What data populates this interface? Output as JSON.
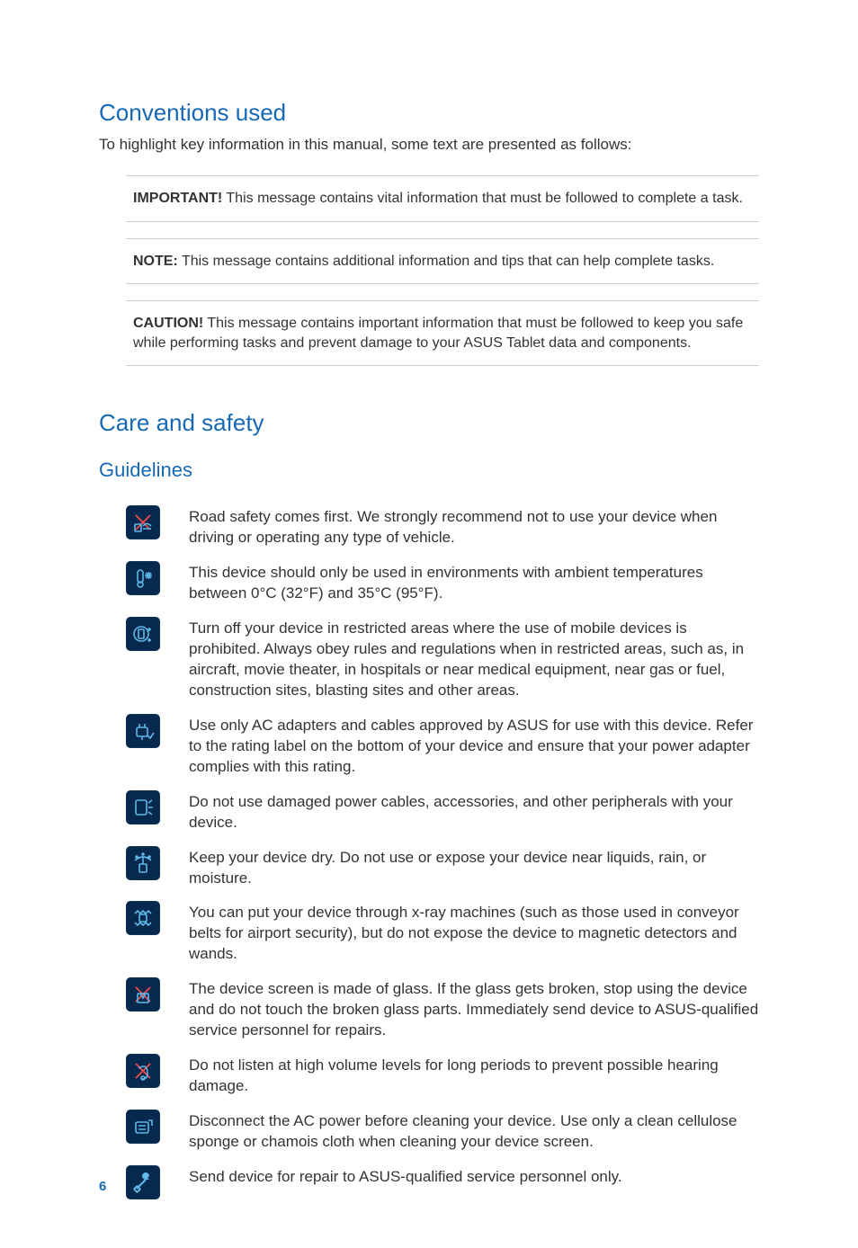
{
  "sections": {
    "conventions": {
      "title": "Conventions used",
      "intro": "To highlight key information in this manual, some text are presented as follows:",
      "callouts": [
        {
          "lead": "IMPORTANT!",
          "text": " This message contains vital information that must be followed to complete a task."
        },
        {
          "lead": "NOTE:",
          "text": " This message contains additional information and tips that can help complete tasks."
        },
        {
          "lead": "CAUTION!",
          "text": " This message contains important information that must be followed to keep you safe while performing tasks and prevent damage to your ASUS Tablet data and components."
        }
      ]
    },
    "care": {
      "title": "Care and safety",
      "subtitle": "Guidelines",
      "items": [
        {
          "icon": "no-driving-icon",
          "text": "Road safety comes first. We strongly recommend not to use your device when driving or operating any type of vehicle."
        },
        {
          "icon": "temperature-icon",
          "text": "This device should only be used in environments with ambient temperatures between 0°C (32°F) and 35°C (95°F)."
        },
        {
          "icon": "restricted-area-icon",
          "text": "Turn off your device in restricted areas where the use of mobile devices is prohibited. Always obey rules and regulations when in restricted areas, such as, in aircraft, movie theater, in hospitals or near medical equipment, near gas or fuel, construction sites, blasting sites and other areas."
        },
        {
          "icon": "approved-adapter-icon",
          "text": "Use only AC adapters and cables approved by ASUS for use with this device. Refer to the rating label on the bottom of your device and ensure that your power adapter complies with this rating."
        },
        {
          "icon": "damaged-cable-icon",
          "text": "Do not use damaged power cables, accessories, and other peripherals with your device."
        },
        {
          "icon": "keep-dry-icon",
          "text": "Keep your device dry. Do not use or expose your device near liquids, rain, or moisture."
        },
        {
          "icon": "xray-icon",
          "text": "You can put your device through x-ray machines (such as those used in conveyor belts for airport security), but do not expose the device to magnetic detectors and wands."
        },
        {
          "icon": "broken-glass-icon",
          "text": "The device screen is made of glass. If the glass gets broken, stop using the device and do not touch the broken glass parts. Immediately send device to ASUS-qualified service personnel for repairs."
        },
        {
          "icon": "hearing-icon",
          "text": "Do not listen at high volume levels for long periods to prevent possible hearing damage."
        },
        {
          "icon": "cleaning-icon",
          "text": "Disconnect the AC power before cleaning your device. Use only a clean cellulose sponge or chamois cloth when cleaning your device screen."
        },
        {
          "icon": "repair-icon",
          "text": "Send device for repair to ASUS-qualified service personnel only."
        }
      ]
    }
  },
  "icons": {
    "no-driving-icon": "no-driving",
    "temperature-icon": "temperature",
    "restricted-area-icon": "restricted",
    "approved-adapter-icon": "adapter",
    "damaged-cable-icon": "damaged-cable",
    "keep-dry-icon": "keep-dry",
    "xray-icon": "xray",
    "broken-glass-icon": "broken-glass",
    "hearing-icon": "hearing",
    "cleaning-icon": "cleaning",
    "repair-icon": "repair"
  },
  "page_number": "6"
}
